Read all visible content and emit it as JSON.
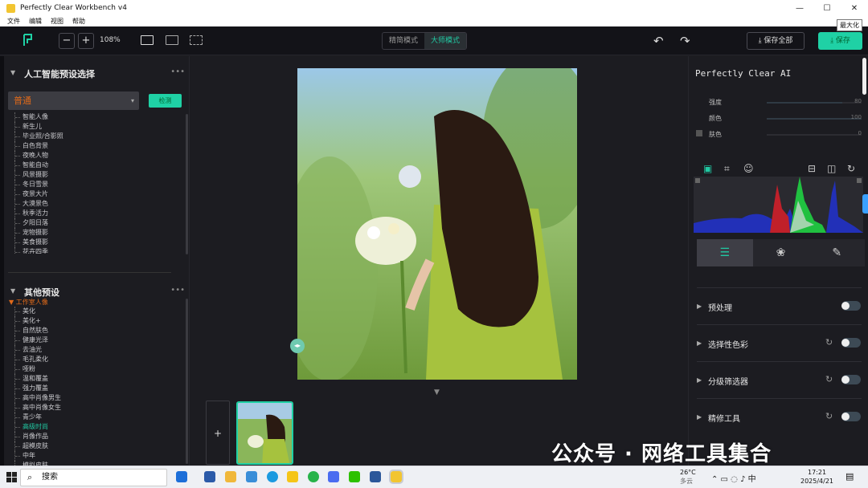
{
  "window": {
    "title": "Perfectly Clear Workbench v4",
    "tooltip": "最大化",
    "min": "—",
    "max": "☐",
    "close": "✕"
  },
  "menu": [
    "文件",
    "编辑",
    "视图",
    "帮助"
  ],
  "toolbar": {
    "zoom_out": "−",
    "zoom_in": "+",
    "zoom": "108%",
    "mode_simple": "精简模式",
    "mode_master": "大师模式",
    "save_all": "保存全部",
    "save": "保存",
    "undo": "↶",
    "redo": "↷"
  },
  "left": {
    "ai_title": "人工智能预设选择",
    "preset_value": "普通",
    "detect": "检测",
    "ai_presets": [
      "智能人像",
      "新生儿",
      "毕业照/合影照",
      "白色背景",
      "夜晚人物",
      "智能自动",
      "风景摄影",
      "冬日雪景",
      "夜景大片",
      "大漠景色",
      "秋季活力",
      "夕阳日落",
      "宠物摄影",
      "美食摄影",
      "花卉四季"
    ],
    "other_title": "其他预设",
    "group_open": "▼ 工作室人像",
    "other_presets": [
      "美化",
      "美化+",
      "自然肤色",
      "健康光泽",
      "去油光",
      "毛孔柔化",
      "哑粉",
      "温和覆盖",
      "强力覆盖",
      "高中肖像男生",
      "高中肖像女生",
      "青少年",
      "高级时尚",
      "肖像作品",
      "超模皮肤",
      "中年",
      "模拟皮肤"
    ],
    "highlight_index": 12
  },
  "right": {
    "title": "Perfectly Clear AI",
    "sliders": [
      {
        "label": "强度",
        "value": "80",
        "pct": 80
      },
      {
        "label": "颜色",
        "value": "100",
        "pct": 100
      },
      {
        "label": "肤色",
        "value": "0",
        "pct": 0
      }
    ],
    "sections": [
      {
        "label": "预处理",
        "reset": false
      },
      {
        "label": "选择性色彩",
        "reset": true
      },
      {
        "label": "分级筛选器",
        "reset": true
      },
      {
        "label": "精修工具",
        "reset": true
      }
    ]
  },
  "taskbar": {
    "search": "搜索",
    "temp": "26°C",
    "weather": "多云",
    "time": "17:21",
    "date": "2025/4/21",
    "ime": "中"
  },
  "watermark": "公众号 · 网络工具集合"
}
